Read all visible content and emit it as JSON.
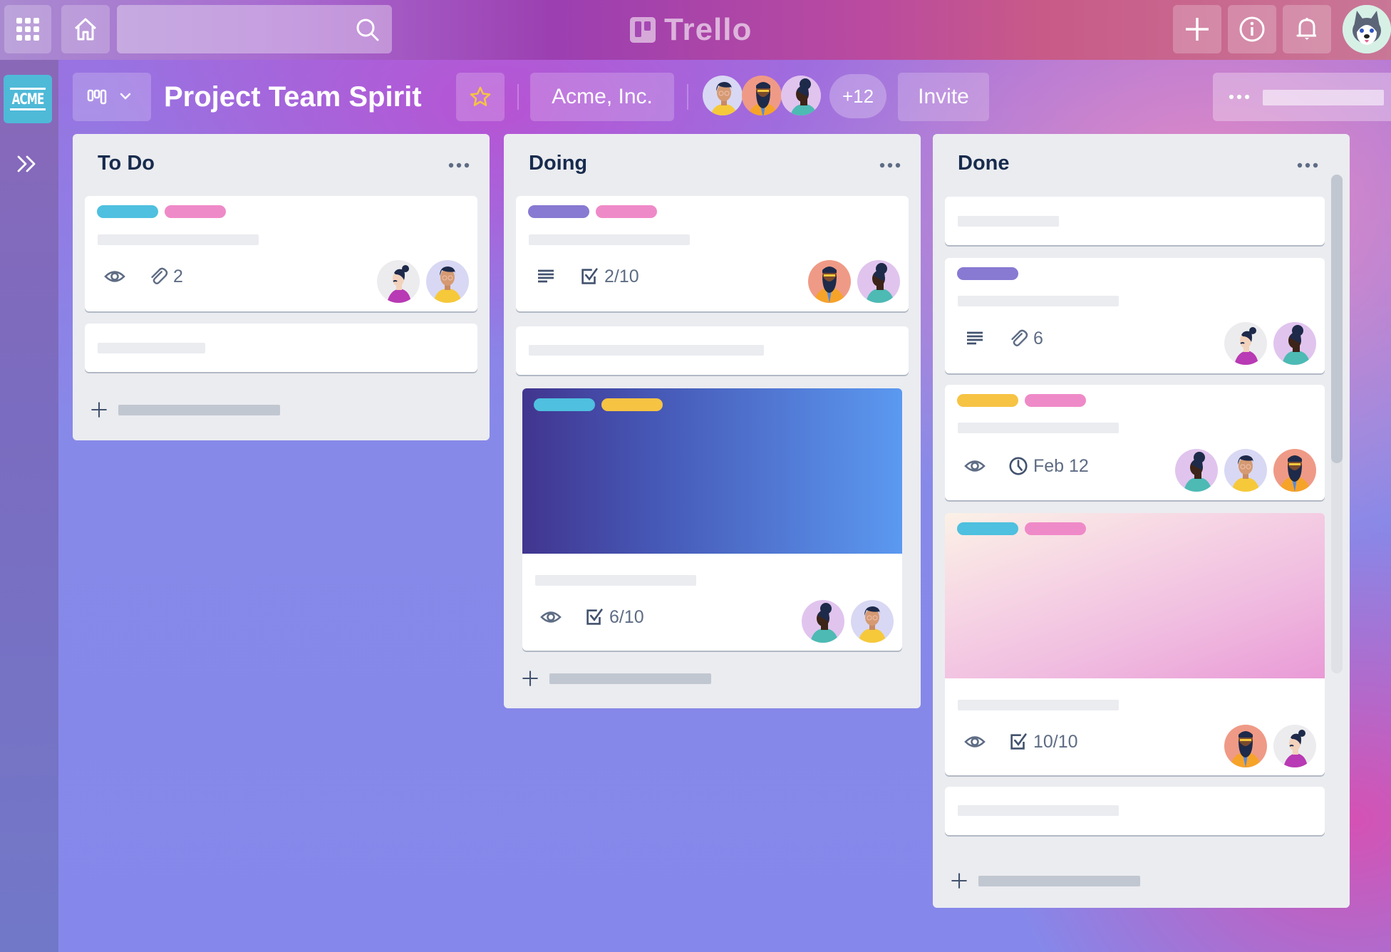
{
  "app": {
    "name": "Trello",
    "search": {
      "placeholder": "",
      "value": ""
    },
    "icons": {
      "apps": "grid-icon",
      "home": "home-icon",
      "search": "search-icon",
      "create": "plus-icon",
      "info": "info-icon",
      "notifications": "bell-icon",
      "account": "husky-avatar"
    }
  },
  "sidebar": {
    "workspace_logo": "ACME",
    "expand_icon": "double-chevron-right-icon"
  },
  "board": {
    "title": "Project Team Spirit",
    "starred": false,
    "workspace": "Acme, Inc.",
    "members": [
      "member-glasses-yellow",
      "member-beard-orange",
      "member-bun-teal"
    ],
    "extra_members": "+12",
    "invite_label": "Invite",
    "colors": {
      "label_blue": "#4fc0df",
      "label_pink": "#ef8ac8",
      "label_purple": "#8879d2",
      "label_yellow": "#f6c343",
      "star": "#f6c343"
    }
  },
  "lists": [
    {
      "title": "To Do",
      "cards": [
        {
          "labels": [
            "blue",
            "pink"
          ],
          "badges": [
            {
              "icon": "eye-icon",
              "text": ""
            },
            {
              "icon": "paperclip-icon",
              "text": "2"
            }
          ],
          "members": [
            "woman-bun-magenta",
            "glasses-yellow"
          ]
        },
        {
          "labels": [],
          "badges": [],
          "members": []
        }
      ],
      "add_card": ""
    },
    {
      "title": "Doing",
      "cards": [
        {
          "labels": [
            "purple",
            "pink"
          ],
          "badges": [
            {
              "icon": "description-icon",
              "text": ""
            },
            {
              "icon": "checklist-icon",
              "text": "2/10"
            }
          ],
          "members": [
            "beard-orange",
            "bun-teal"
          ]
        },
        {
          "labels": [],
          "badges": [],
          "members": []
        },
        {
          "cover": "blue-gradient",
          "labels": [
            "blue",
            "yellow"
          ],
          "badges": [
            {
              "icon": "eye-icon",
              "text": ""
            },
            {
              "icon": "checklist-icon",
              "text": "6/10"
            }
          ],
          "members": [
            "bun-teal",
            "glasses-yellow"
          ]
        }
      ],
      "add_card": ""
    },
    {
      "title": "Done",
      "cards": [
        {
          "labels": [],
          "badges": [],
          "members": []
        },
        {
          "labels": [
            "purple"
          ],
          "badges": [
            {
              "icon": "description-icon",
              "text": ""
            },
            {
              "icon": "paperclip-icon",
              "text": "6"
            }
          ],
          "members": [
            "woman-bun-magenta",
            "bun-teal"
          ]
        },
        {
          "labels": [
            "yellow",
            "pink"
          ],
          "badges": [
            {
              "icon": "eye-icon",
              "text": ""
            },
            {
              "icon": "clock-icon",
              "text": "Feb 12"
            }
          ],
          "members": [
            "bun-teal",
            "glasses-yellow",
            "beard-orange"
          ]
        },
        {
          "cover": "pink-gradient",
          "labels": [
            "blue",
            "pink"
          ],
          "badges": [
            {
              "icon": "eye-icon",
              "text": ""
            },
            {
              "icon": "checklist-icon",
              "text": "10/10"
            }
          ],
          "members": [
            "beard-orange",
            "woman-bun-magenta"
          ]
        },
        {
          "labels": [],
          "badges": [],
          "members": []
        }
      ],
      "add_card": "",
      "scroll_position": 0
    }
  ]
}
